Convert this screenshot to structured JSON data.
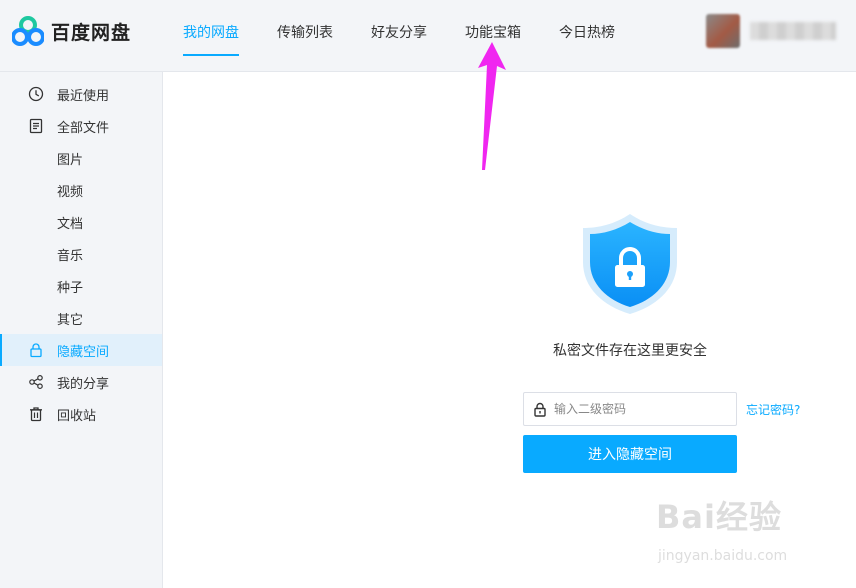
{
  "app": {
    "name": "百度网盘",
    "brand_colors": {
      "accent": "#09aaff",
      "logo_blue": "#1a8cff",
      "logo_green": "#1ec8a0"
    }
  },
  "header": {
    "nav": [
      {
        "label": "我的网盘",
        "active": true
      },
      {
        "label": "传输列表",
        "active": false
      },
      {
        "label": "好友分享",
        "active": false
      },
      {
        "label": "功能宝箱",
        "active": false
      },
      {
        "label": "今日热榜",
        "active": false
      }
    ]
  },
  "sidebar": {
    "items": [
      {
        "label": "最近使用",
        "icon": "clock-icon",
        "active": false
      },
      {
        "label": "全部文件",
        "icon": "file-icon",
        "active": false
      },
      {
        "label": "图片",
        "icon": "",
        "active": false
      },
      {
        "label": "视频",
        "icon": "",
        "active": false
      },
      {
        "label": "文档",
        "icon": "",
        "active": false
      },
      {
        "label": "音乐",
        "icon": "",
        "active": false
      },
      {
        "label": "种子",
        "icon": "",
        "active": false
      },
      {
        "label": "其它",
        "icon": "",
        "active": false
      },
      {
        "label": "隐藏空间",
        "icon": "lock-icon",
        "active": true
      },
      {
        "label": "我的分享",
        "icon": "share-icon",
        "active": false
      },
      {
        "label": "回收站",
        "icon": "trash-icon",
        "active": false
      }
    ]
  },
  "hidden_space": {
    "tagline": "私密文件存在这里更安全",
    "password_placeholder": "输入二级密码",
    "password_value": "",
    "forgot_link": "忘记密码?",
    "enter_button": "进入隐藏空间"
  },
  "annotation": {
    "arrow_color": "#f026f0"
  },
  "watermark": {
    "brand": "Bai经验",
    "url": "jingyan.baidu.com"
  }
}
